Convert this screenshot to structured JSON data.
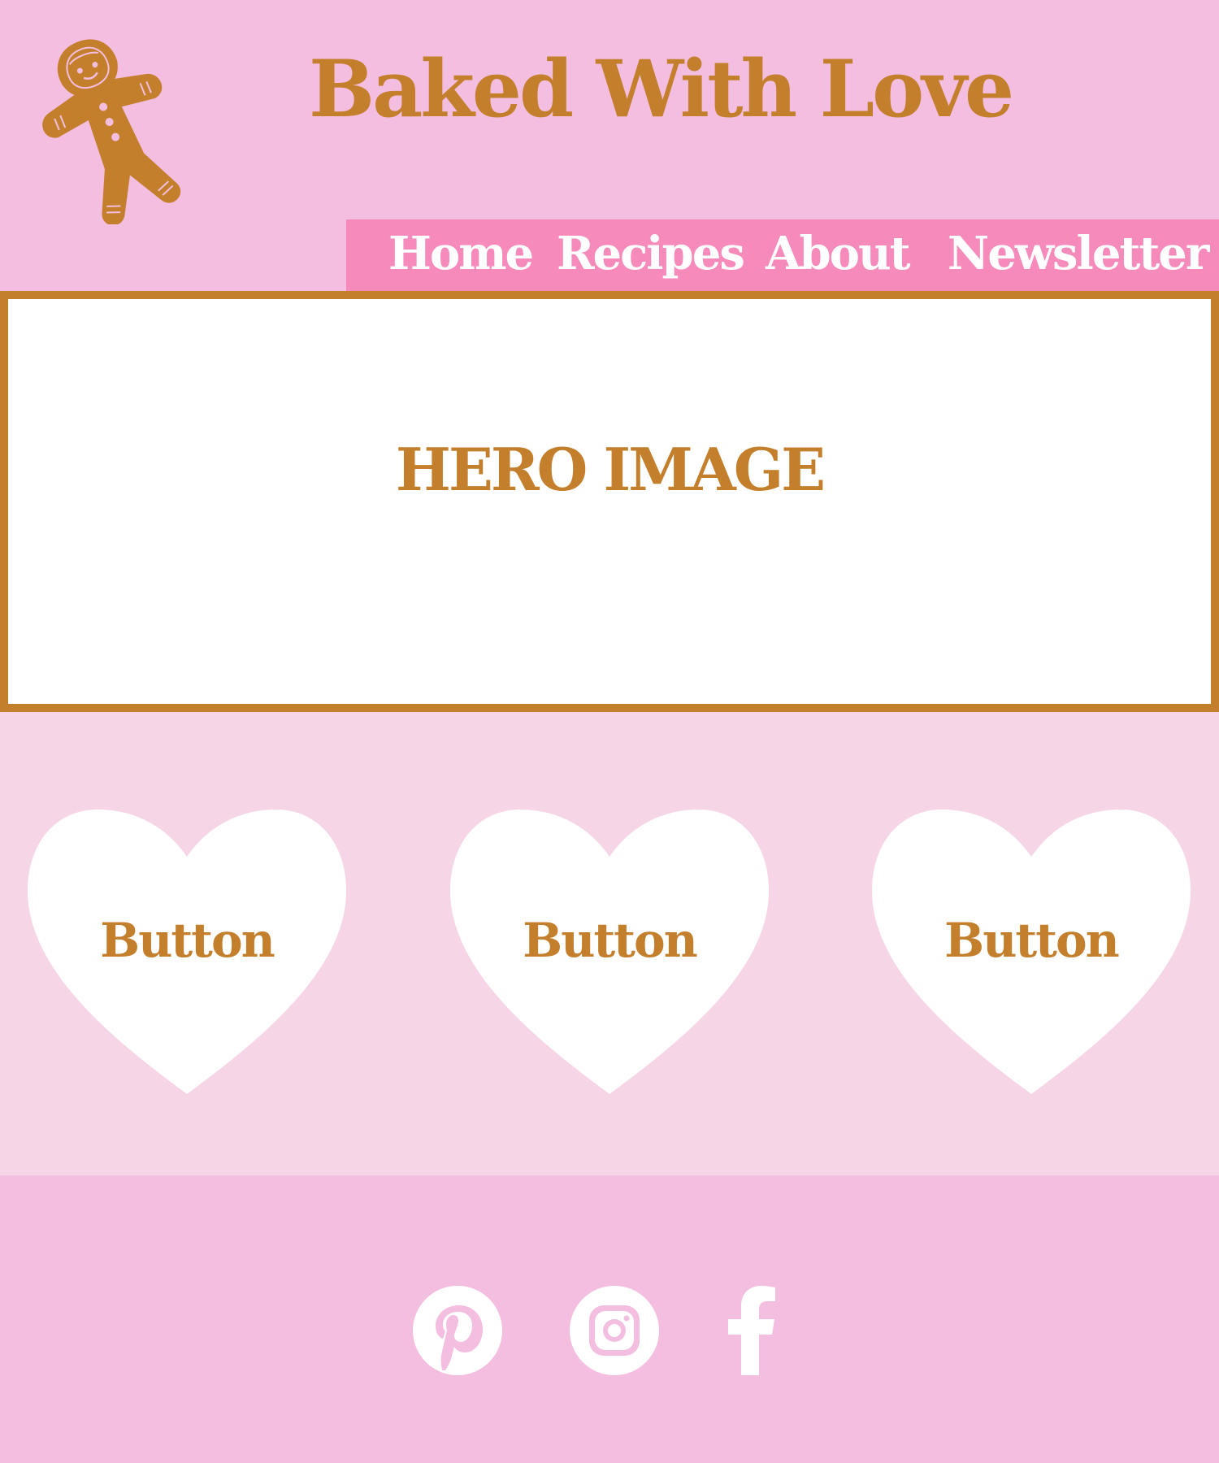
{
  "colors": {
    "background": "#f3bedf",
    "accent": "#c47f2d",
    "nav_background": "#f58abb",
    "button_band": "#f5d5e6",
    "white": "#ffffff"
  },
  "header": {
    "logo_icon": "gingerbread-man-icon",
    "title": "Baked With Love"
  },
  "nav": {
    "items": [
      {
        "label": "Home"
      },
      {
        "label": "Recipes"
      },
      {
        "label": "About"
      },
      {
        "label": "Newsletter"
      }
    ]
  },
  "hero": {
    "label": "HERO IMAGE"
  },
  "buttons": [
    {
      "label": "Button",
      "shape": "heart"
    },
    {
      "label": "Button",
      "shape": "heart"
    },
    {
      "label": "Button",
      "shape": "heart"
    }
  ],
  "footer": {
    "social_icons": [
      "pinterest-icon",
      "instagram-icon",
      "facebook-icon"
    ]
  }
}
